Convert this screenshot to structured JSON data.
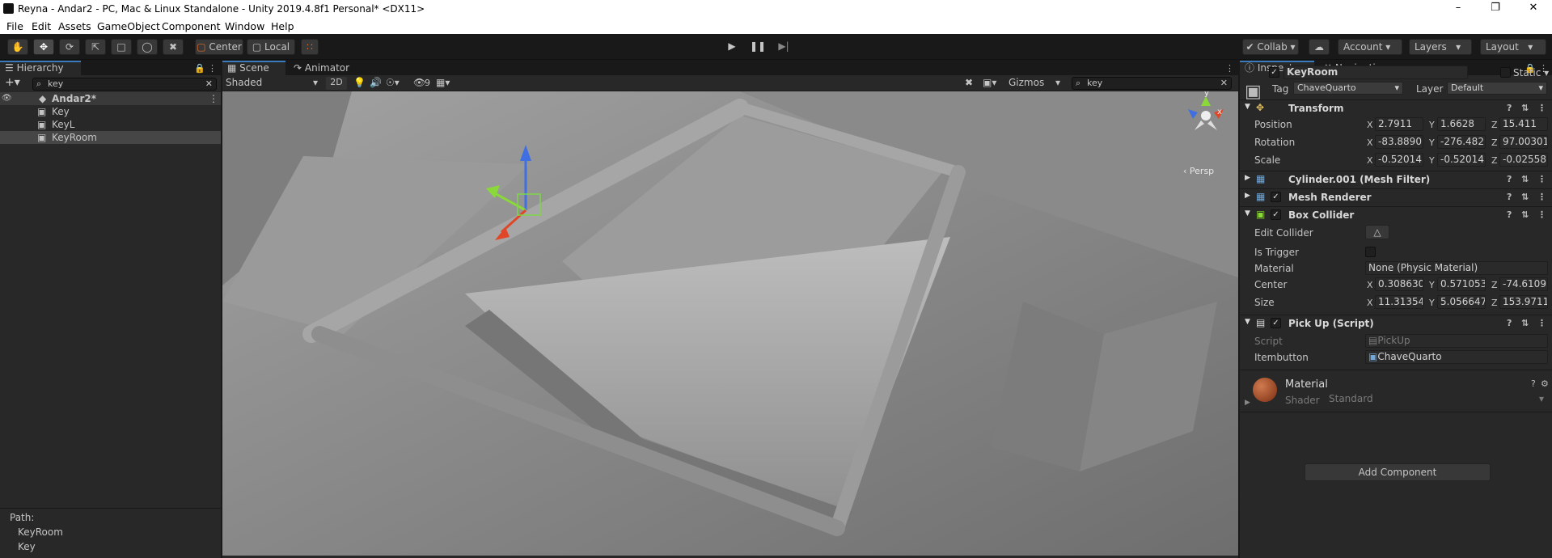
{
  "window": {
    "title": "Reyna - Andar2 - PC, Mac & Linux Standalone - Unity 2019.4.8f1 Personal* <DX11>"
  },
  "menu": [
    "File",
    "Edit",
    "Assets",
    "GameObject",
    "Component",
    "Window",
    "Help"
  ],
  "toolbar": {
    "pivot": "Center",
    "space": "Local",
    "collab": "Collab",
    "account": "Account",
    "layers": "Layers",
    "layout": "Layout"
  },
  "hierarchy": {
    "tab": "Hierarchy",
    "search": "key",
    "scene": "Andar2*",
    "items": [
      "Key",
      "KeyL",
      "KeyRoom"
    ],
    "path_label": "Path:",
    "path": [
      "KeyRoom",
      "Key"
    ]
  },
  "scene": {
    "tabs": [
      "Scene",
      "Animator"
    ],
    "shading": "Shaded",
    "mode2d": "2D",
    "hidden_count": "9",
    "gizmos": "Gizmos",
    "search": "key",
    "persp": "Persp",
    "gizmo_axes": {
      "x": "x",
      "y": "y"
    }
  },
  "inspector": {
    "tabs": [
      "Inspector",
      "Navigation"
    ],
    "name": "KeyRoom",
    "static": "Static",
    "tag_label": "Tag",
    "tag": "ChaveQuarto",
    "layer_label": "Layer",
    "layer": "Default",
    "transform": {
      "title": "Transform",
      "position": {
        "label": "Position",
        "x": "2.7911",
        "y": "1.6628",
        "z": "15.411"
      },
      "rotation": {
        "label": "Rotation",
        "x": "-83.88901",
        "y": "-276.482",
        "z": "97.00301"
      },
      "scale": {
        "label": "Scale",
        "x": "-0.520143",
        "y": "-0.520143",
        "z": "-0.025581"
      }
    },
    "mesh_filter": "Cylinder.001 (Mesh Filter)",
    "mesh_renderer": "Mesh Renderer",
    "box_collider": {
      "title": "Box Collider",
      "edit_label": "Edit Collider",
      "trigger_label": "Is Trigger",
      "material_label": "Material",
      "material": "None (Physic Material)",
      "center": {
        "label": "Center",
        "x": "0.308630",
        "y": "0.571053",
        "z": "-74.61095"
      },
      "size": {
        "label": "Size",
        "x": "11.31354",
        "y": "5.056647",
        "z": "153.9711"
      }
    },
    "pickup": {
      "title": "Pick Up (Script)",
      "script_label": "Script",
      "script": "PickUp",
      "item_label": "Itembutton",
      "item": "ChaveQuarto"
    },
    "material": {
      "title": "Material",
      "shader_label": "Shader",
      "shader": "Standard"
    },
    "add_component": "Add Component"
  },
  "colors": {
    "selection": "#3a79bb",
    "panel": "#282828",
    "toolbar": "#191919",
    "viewport": "#8e8e8e"
  }
}
